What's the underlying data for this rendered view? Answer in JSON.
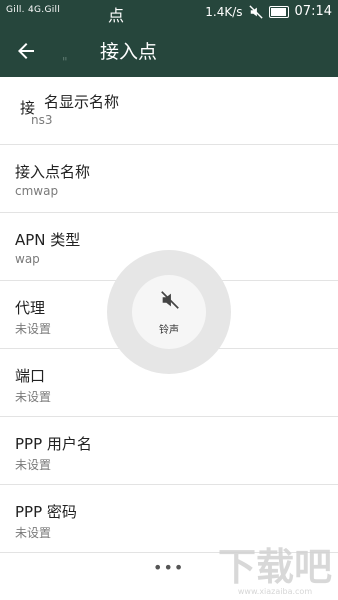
{
  "status_bar": {
    "signal_left": "Gill. 4G.Gill",
    "ghost_char": "点",
    "speed": "1.4K/s",
    "time": "07:14",
    "icons": [
      "signal-icon",
      "mute-icon",
      "battery-icon"
    ]
  },
  "toolbar": {
    "title": "接入点",
    "ghost_mark": "\"",
    "back_icon": "arrow-left-icon"
  },
  "items": [
    {
      "label": "名显示名称",
      "value": "ns3",
      "overlap": "接"
    },
    {
      "label": "接入点名称",
      "value": "cmwap"
    },
    {
      "label": "APN 类型",
      "value": "wap"
    },
    {
      "label": "代理",
      "value": "未设置"
    },
    {
      "label": "端口",
      "value": "未设置"
    },
    {
      "label": "PPP 用户名",
      "value": "未设置"
    },
    {
      "label": "PPP 密码",
      "value": "未设置"
    }
  ],
  "volume_popup": {
    "label": "铃声",
    "icon": "speaker-muted-icon"
  },
  "more_label": "•••",
  "watermark": {
    "text": "下载吧",
    "sub": "www.xiazaiba.com"
  },
  "colors": {
    "header_bg": "#26463c",
    "divider": "#e3e3e3"
  }
}
